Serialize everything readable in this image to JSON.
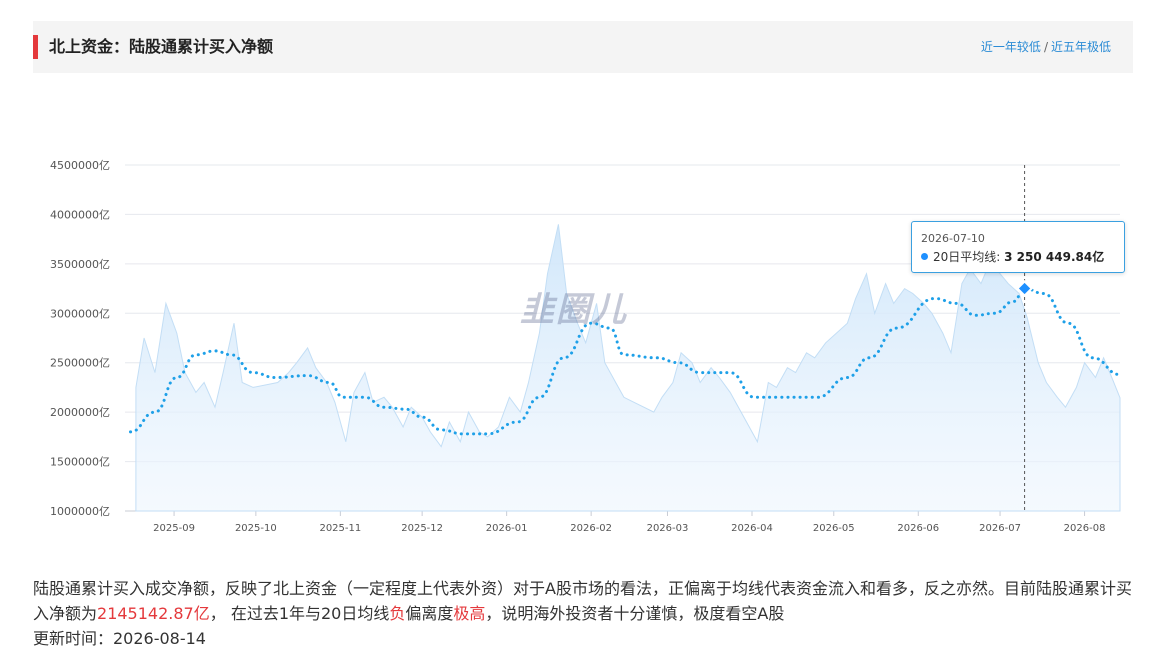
{
  "header": {
    "title": "北上资金：陆股通累计买入净额",
    "link_year": "近一年较低",
    "separator": "/",
    "link_five": "近五年极低"
  },
  "watermark": "韭圈儿",
  "tooltip": {
    "date": "2026-07-10",
    "series": "20日平均线:",
    "value": "3 250 449.84亿"
  },
  "description": {
    "part1": "陆股通累计买入成交净额，反映了北上资金（一定程度上代表外资）对于A股市场的看法，正偏离于均线代表资金流入和看多，反之亦然。目前陆股通累计买入净额为",
    "current_value": "2145142.87亿",
    "part2": "， 在过去1年与20日均线",
    "direction": "负",
    "part3": "偏离度",
    "level": "极高",
    "part4": "，说明海外投资者十分谨慎，极度看空A股"
  },
  "update_time": "更新时间：2026-08-14",
  "colors": {
    "accent_red": "#e4393c",
    "link_blue": "#2a8bd5",
    "area_fill": "#dcedfb",
    "ma_line": "#1ea0e8"
  },
  "chart_data": {
    "type": "area",
    "y_tick_labels": [
      "1000000亿",
      "1500000亿",
      "2000000亿",
      "2500000亿",
      "3000000亿",
      "3500000亿",
      "4000000亿",
      "4500000亿"
    ],
    "y_ticks": [
      1000000,
      1500000,
      2000000,
      2500000,
      3000000,
      3500000,
      4000000,
      4500000
    ],
    "ylim": [
      1000000,
      4500000
    ],
    "x_tick_labels": [
      "2025-09",
      "2025-10",
      "2025-11",
      "2025-12",
      "2026-01",
      "2026-02",
      "2026-03",
      "2026-04",
      "2026-05",
      "2026-06",
      "2026-07",
      "2026-08"
    ],
    "x_ticks": [
      "2025-09-01",
      "2025-10-01",
      "2025-11-01",
      "2025-12-01",
      "2026-01-01",
      "2026-02-01",
      "2026-03-01",
      "2026-04-01",
      "2026-05-01",
      "2026-06-01",
      "2026-07-01",
      "2026-08-01"
    ],
    "x_range": [
      "2025-08-14",
      "2026-08-14"
    ],
    "highlight_date": "2026-07-10",
    "grid": true,
    "series": [
      {
        "style": "area",
        "points": [
          [
            "2025-08-18",
            2250000
          ],
          [
            "2025-08-21",
            2750000
          ],
          [
            "2025-08-25",
            2400000
          ],
          [
            "2025-08-29",
            3100000
          ],
          [
            "2025-09-02",
            2800000
          ],
          [
            "2025-09-05",
            2400000
          ],
          [
            "2025-09-09",
            2200000
          ],
          [
            "2025-09-12",
            2300000
          ],
          [
            "2025-09-16",
            2050000
          ],
          [
            "2025-09-19",
            2400000
          ],
          [
            "2025-09-23",
            2900000
          ],
          [
            "2025-09-26",
            2300000
          ],
          [
            "2025-09-30",
            2250000
          ],
          [
            "2025-10-09",
            2300000
          ],
          [
            "2025-10-13",
            2400000
          ],
          [
            "2025-10-16",
            2500000
          ],
          [
            "2025-10-20",
            2650000
          ],
          [
            "2025-10-23",
            2450000
          ],
          [
            "2025-10-27",
            2300000
          ],
          [
            "2025-10-30",
            2100000
          ],
          [
            "2025-11-03",
            1700000
          ],
          [
            "2025-11-06",
            2200000
          ],
          [
            "2025-11-10",
            2400000
          ],
          [
            "2025-11-13",
            2100000
          ],
          [
            "2025-11-17",
            2150000
          ],
          [
            "2025-11-20",
            2050000
          ],
          [
            "2025-11-24",
            1850000
          ],
          [
            "2025-11-27",
            2050000
          ],
          [
            "2025-12-01",
            1950000
          ],
          [
            "2025-12-04",
            1800000
          ],
          [
            "2025-12-08",
            1650000
          ],
          [
            "2025-12-11",
            1900000
          ],
          [
            "2025-12-15",
            1700000
          ],
          [
            "2025-12-18",
            2000000
          ],
          [
            "2025-12-22",
            1800000
          ],
          [
            "2025-12-25",
            1750000
          ],
          [
            "2025-12-29",
            1850000
          ],
          [
            "2026-01-02",
            2150000
          ],
          [
            "2026-01-06",
            2000000
          ],
          [
            "2026-01-09",
            2300000
          ],
          [
            "2026-01-13",
            2800000
          ],
          [
            "2026-01-16",
            3400000
          ],
          [
            "2026-01-20",
            3900000
          ],
          [
            "2026-01-23",
            3200000
          ],
          [
            "2026-01-27",
            2900000
          ],
          [
            "2026-01-30",
            2700000
          ],
          [
            "2026-02-03",
            3100000
          ],
          [
            "2026-02-06",
            2500000
          ],
          [
            "2026-02-10",
            2300000
          ],
          [
            "2026-02-13",
            2150000
          ],
          [
            "2026-02-24",
            2000000
          ],
          [
            "2026-02-27",
            2150000
          ],
          [
            "2026-03-03",
            2300000
          ],
          [
            "2026-03-06",
            2600000
          ],
          [
            "2026-03-10",
            2500000
          ],
          [
            "2026-03-13",
            2300000
          ],
          [
            "2026-03-17",
            2450000
          ],
          [
            "2026-03-20",
            2350000
          ],
          [
            "2026-03-24",
            2200000
          ],
          [
            "2026-03-27",
            2050000
          ],
          [
            "2026-03-31",
            1850000
          ],
          [
            "2026-04-03",
            1700000
          ],
          [
            "2026-04-07",
            2300000
          ],
          [
            "2026-04-10",
            2250000
          ],
          [
            "2026-04-14",
            2450000
          ],
          [
            "2026-04-17",
            2400000
          ],
          [
            "2026-04-21",
            2600000
          ],
          [
            "2026-04-24",
            2550000
          ],
          [
            "2026-04-28",
            2700000
          ],
          [
            "2026-05-06",
            2900000
          ],
          [
            "2026-05-09",
            3150000
          ],
          [
            "2026-05-13",
            3400000
          ],
          [
            "2026-05-16",
            3000000
          ],
          [
            "2026-05-20",
            3300000
          ],
          [
            "2026-05-23",
            3100000
          ],
          [
            "2026-05-27",
            3250000
          ],
          [
            "2026-05-30",
            3200000
          ],
          [
            "2026-06-03",
            3100000
          ],
          [
            "2026-06-06",
            3000000
          ],
          [
            "2026-06-10",
            2800000
          ],
          [
            "2026-06-13",
            2600000
          ],
          [
            "2026-06-17",
            3300000
          ],
          [
            "2026-06-20",
            3450000
          ],
          [
            "2026-06-24",
            3300000
          ],
          [
            "2026-06-27",
            3500000
          ],
          [
            "2026-07-01",
            3400000
          ],
          [
            "2026-07-04",
            3300000
          ],
          [
            "2026-07-08",
            3200000
          ],
          [
            "2026-07-11",
            2950000
          ],
          [
            "2026-07-15",
            2500000
          ],
          [
            "2026-07-18",
            2300000
          ],
          [
            "2026-07-22",
            2150000
          ],
          [
            "2026-07-25",
            2050000
          ],
          [
            "2026-07-29",
            2250000
          ],
          [
            "2026-08-01",
            2500000
          ],
          [
            "2026-08-05",
            2350000
          ],
          [
            "2026-08-08",
            2550000
          ],
          [
            "2026-08-11",
            2350000
          ],
          [
            "2026-08-14",
            2145143
          ]
        ]
      },
      {
        "name": "20日平均线",
        "style": "dotted-line",
        "points": [
          [
            "2025-08-16",
            1800000
          ],
          [
            "2025-08-25",
            2000000
          ],
          [
            "2025-09-02",
            2350000
          ],
          [
            "2025-09-09",
            2580000
          ],
          [
            "2025-09-16",
            2620000
          ],
          [
            "2025-09-22",
            2580000
          ],
          [
            "2025-09-30",
            2400000
          ],
          [
            "2025-10-08",
            2350000
          ],
          [
            "2025-10-20",
            2370000
          ],
          [
            "2025-10-28",
            2300000
          ],
          [
            "2025-11-02",
            2150000
          ],
          [
            "2025-11-10",
            2150000
          ],
          [
            "2025-11-17",
            2050000
          ],
          [
            "2025-11-25",
            2030000
          ],
          [
            "2025-12-01",
            1950000
          ],
          [
            "2025-12-08",
            1820000
          ],
          [
            "2025-12-16",
            1780000
          ],
          [
            "2025-12-25",
            1780000
          ],
          [
            "2026-01-05",
            1900000
          ],
          [
            "2026-01-13",
            2150000
          ],
          [
            "2026-01-22",
            2550000
          ],
          [
            "2026-02-01",
            2900000
          ],
          [
            "2026-02-08",
            2850000
          ],
          [
            "2026-02-13",
            2580000
          ],
          [
            "2026-02-25",
            2550000
          ],
          [
            "2026-03-05",
            2500000
          ],
          [
            "2026-03-13",
            2400000
          ],
          [
            "2026-03-24",
            2400000
          ],
          [
            "2026-04-02",
            2150000
          ],
          [
            "2026-04-10",
            2150000
          ],
          [
            "2026-04-25",
            2150000
          ],
          [
            "2026-05-06",
            2350000
          ],
          [
            "2026-05-14",
            2550000
          ],
          [
            "2026-05-24",
            2850000
          ],
          [
            "2026-06-07",
            3150000
          ],
          [
            "2026-06-15",
            3100000
          ],
          [
            "2026-06-22",
            2980000
          ],
          [
            "2026-06-29",
            3000000
          ],
          [
            "2026-07-06",
            3120000
          ],
          [
            "2026-07-10",
            3250450
          ],
          [
            "2026-07-17",
            3200000
          ],
          [
            "2026-07-26",
            2900000
          ],
          [
            "2026-08-04",
            2550000
          ],
          [
            "2026-08-14",
            2380000
          ]
        ]
      }
    ]
  }
}
